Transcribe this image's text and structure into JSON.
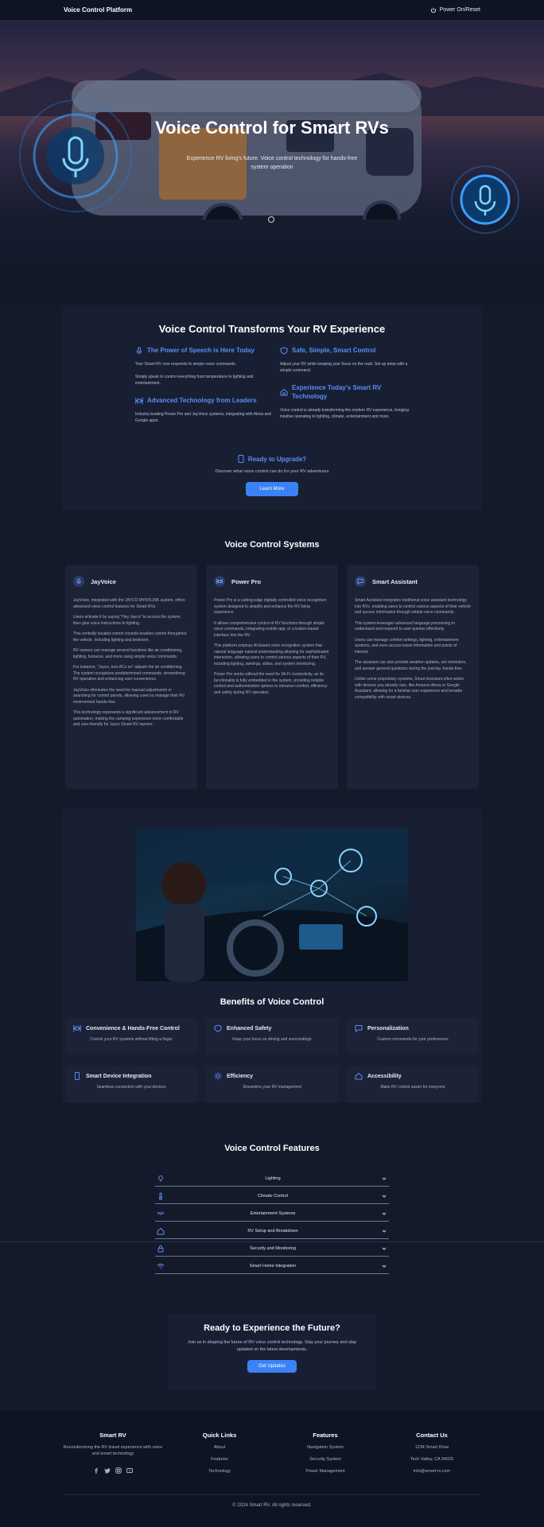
{
  "topbar": {
    "brand": "Voice Control Platform",
    "power_label": "Power On/Reset"
  },
  "hero": {
    "title": "Voice Control for Smart RVs",
    "subtitle": "Experience RV living's future. Voice control technology for hands-free system operation"
  },
  "transform": {
    "title": "Voice Control Transforms Your RV Experience",
    "features": [
      {
        "icon": "mic-icon",
        "title": "The Power of Speech is Here Today",
        "lines": [
          "Your Smart RV now responds to simple voice commands.",
          "Simply speak to control everything from temperature to lighting and entertainment."
        ]
      },
      {
        "icon": "shield-icon",
        "title": "Safe, Simple, Smart Control",
        "lines": [
          "Adjust your RV while keeping your focus on the road. Set up temp with a simple command."
        ]
      },
      {
        "icon": "command-icon",
        "title": "Advanced Technology from Leaders",
        "lines": [
          "Industry-leading Power Pro and JayVoice systems, integrating with Alexa and Google apps."
        ]
      },
      {
        "icon": "home-icon",
        "title": "Experience Today's Smart RV Technology",
        "lines": [
          "Voice control is already transforming the modern RV experience, bringing intuitive operating to lighting, climate, entertainment and more."
        ]
      }
    ],
    "upgrade_title": "Ready to Upgrade?",
    "upgrade_text": "Discover what voice control can do for your RV adventures",
    "upgrade_button": "Learn More"
  },
  "systems": {
    "title": "Voice Control Systems",
    "cards": [
      {
        "icon": "mic-icon",
        "title": "JayVoice",
        "paragraphs": [
          "JayVoice, integrated with the JAYCO MYRVLINK system, offers advanced voice control features for Smart RVs.",
          "Users activate it by saying \"Hey Jayco\" to access the system, then give voice instructions to lighting.",
          "This centrally located control console enables control throughout the vehicle, including lighting and bedroom.",
          "RV owners can manage several functions like air conditioning, lighting, furnaces, and more using simple voice commands.",
          "For instance, \"Jayco, turn ACs on\" adjusts the air conditioning. The system recognizes predetermined commands, streamlining RV operation and enhancing user convenience.",
          "JayVoice eliminates the need for manual adjustments or searching for control panels, allowing users to manage their RV environment hands-free.",
          "This technology represents a significant advancement in RV automation, making the camping experience more comfortable and user-friendly for Jayco Smart RV owners."
        ]
      },
      {
        "icon": "command-icon",
        "title": "Power Pro",
        "paragraphs": [
          "Power Pro is a cutting-edge digitally controlled voice recognition system designed to simplify and enhance the RV living experience.",
          "It allows comprehensive control of RV functions through simple voice commands, integrating mobile app, or a button-based interface into the RV.",
          "This platform employs AI-based voice recognition system that natural language natural understanding allowing for sophisticated interaction, allowing users to control various aspects of their RV, including lighting, awnings, slides, and system monitoring.",
          "Power Pro works without the need for Wi-Fi connectivity, as its functionality is fully embedded in the system, providing reliable control and authentication options to enhance comfort, efficiency and safety during RV operation."
        ]
      },
      {
        "icon": "chat-icon",
        "title": "Smart Assistant",
        "paragraphs": [
          "Smart Assistant integrates traditional voice assistant technology into RVs, enabling users to control various aspects of their vehicle and access information through simple voice commands.",
          "This system leverages advanced language processing to understand and respond to user queries effectively.",
          "Users can manage comfort settings, lighting, entertainment systems, and even access travel information and points of interest.",
          "The assistant can also provide weather updates, set reminders, and answer general questions during the journey, hands-free.",
          "Unlike some proprietary systems, Smart Assistant often works with devices you already own, like Amazon Alexa or Google Assistant, allowing for a familiar user experience and broader compatibility with smart devices."
        ]
      }
    ]
  },
  "benefits": {
    "title": "Benefits of Voice Control",
    "items": [
      {
        "icon": "command-icon",
        "title": "Convenience & Hands-Free Control",
        "text": "Control your RV systems without lifting a finger"
      },
      {
        "icon": "shield-icon",
        "title": "Enhanced Safety",
        "text": "Keep your focus on driving and surroundings"
      },
      {
        "icon": "chat-icon",
        "title": "Personalization",
        "text": "Custom commands for your preferences"
      },
      {
        "icon": "phone-icon",
        "title": "Smart Device Integration",
        "text": "Seamless connection with your devices"
      },
      {
        "icon": "sun-icon",
        "title": "Efficiency",
        "text": "Streamline your RV management"
      },
      {
        "icon": "home-icon",
        "title": "Accessibility",
        "text": "Make RV control easier for everyone"
      }
    ]
  },
  "features": {
    "title": "Voice Control Features",
    "items": [
      {
        "icon": "bulb-icon",
        "label": "Lighting"
      },
      {
        "icon": "thermometer-icon",
        "label": "Climate Control"
      },
      {
        "icon": "entertainment-icon",
        "label": "Entertainment Systems"
      },
      {
        "icon": "rv-icon",
        "label": "RV Setup and Breakdown"
      },
      {
        "icon": "lock-icon",
        "label": "Security and Monitoring"
      },
      {
        "icon": "wifi-icon",
        "label": "Smart Home Integration"
      }
    ]
  },
  "cta": {
    "title": "Ready to Experience the Future?",
    "text": "Join us in shaping the future of RV voice control technology. Stay your journey and stay updated on the latest developments.",
    "button": "Get Updates"
  },
  "footer": {
    "columns": [
      {
        "title": "Smart RV",
        "items": [
          "Revolutionizing the RV travel experience with voice and smart technology"
        ]
      },
      {
        "title": "Quick Links",
        "items": [
          "About",
          "Features",
          "Technology"
        ]
      },
      {
        "title": "Features",
        "items": [
          "Navigation System",
          "Security System",
          "Power Management"
        ]
      },
      {
        "title": "Contact Us",
        "items": [
          "1234 Smart Drive",
          "Tech Valley, CA 94025",
          "info@smart-rv.com"
        ]
      }
    ],
    "socials": [
      "facebook-icon",
      "twitter-icon",
      "instagram-icon",
      "youtube-icon"
    ],
    "copyright": "© 2024 Smart RV. All rights reserved."
  },
  "colors": {
    "accent": "#3b82f6",
    "background": "#141a2a",
    "card": "#1c2337"
  }
}
